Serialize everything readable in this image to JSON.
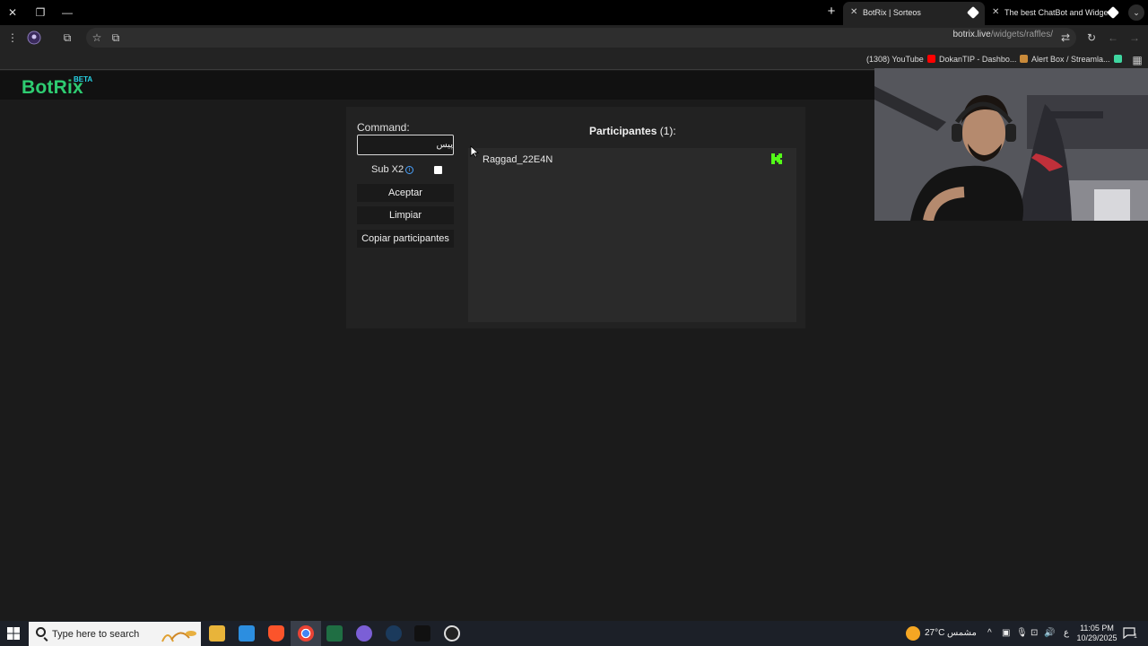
{
  "browser": {
    "tabs": [
      {
        "title": "BotRix | Sorteos",
        "active": true
      },
      {
        "title": "The best ChatBot and Widgets",
        "active": false
      }
    ],
    "url_host": "botrix.live",
    "url_path": "/widgets/raffles/",
    "bookmarks": [
      {
        "label": "(1308) YouTube",
        "color": "#ff0000"
      },
      {
        "label": "DokanTIP - Dashbo...",
        "color": "#c98a3a"
      },
      {
        "label": "Alert Box / Streamla...",
        "color": "#3fd6a0"
      }
    ]
  },
  "site": {
    "logo": "BotRix",
    "badge": "BETA"
  },
  "raffle": {
    "command_label": "Command:",
    "command_value": "پیس",
    "sub_label": "Sub X2",
    "sub_checked": false,
    "accept_label": "Aceptar",
    "clear_label": "Limpiar",
    "copy_label": "Copiar participantes",
    "participants_title": "Participantes",
    "participants_count": "(1):",
    "participants": [
      {
        "name": "Raggad_22E4N",
        "platform": "kick"
      }
    ]
  },
  "taskbar": {
    "search_placeholder": "Type here to search",
    "weather": "27°C",
    "weather_desc": "مشمس",
    "lang": "ع",
    "time": "11:05 PM",
    "date": "10/29/2025",
    "notifications": "1"
  },
  "colors": {
    "brand": "#2ecc71",
    "beta": "#27d3e6",
    "kick": "#53fc18"
  }
}
